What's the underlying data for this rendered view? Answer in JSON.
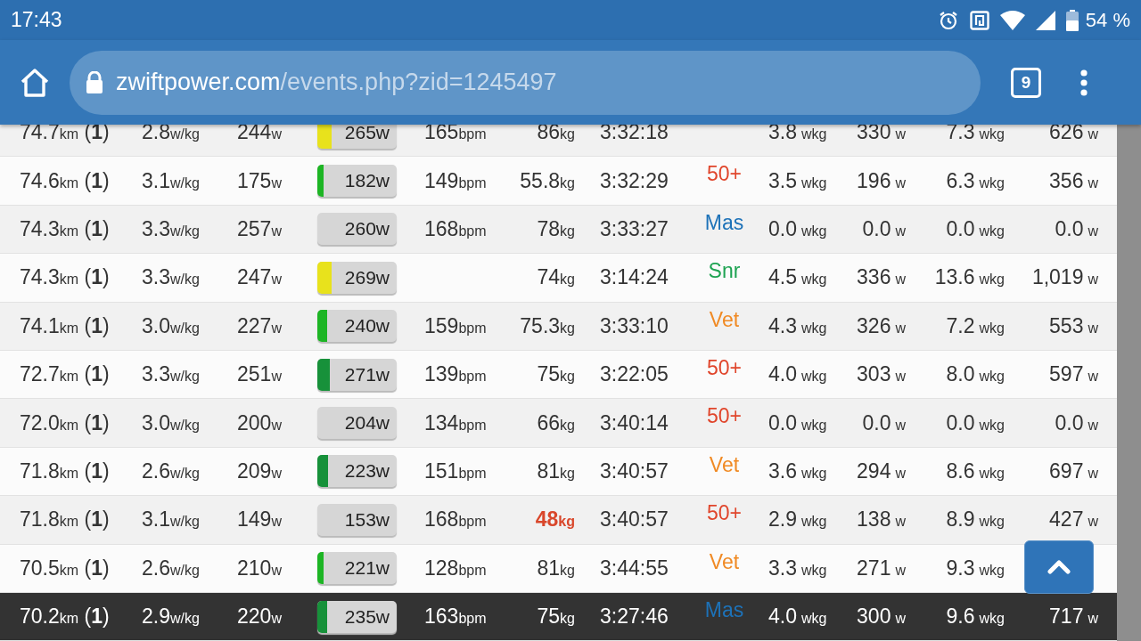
{
  "status_bar": {
    "time": "17:43",
    "battery": "54 %"
  },
  "address_bar": {
    "host": "zwiftpower.com",
    "path": "/events.php?zid=1245497",
    "tab_count": "9"
  },
  "rows": [
    {
      "distance": {
        "v": "74.7",
        "u": "km"
      },
      "rank": "(**1**)",
      "wkg": {
        "v": "2.8",
        "u": "w/kg"
      },
      "avg_power": {
        "v": "244",
        "u": "w"
      },
      "power_bar": {
        "v": "265",
        "u": "w",
        "level": 0.18,
        "color": "#e8e21c"
      },
      "heart_rate": {
        "v": "165",
        "u": "bpm"
      },
      "weight": {
        "v": "86",
        "u": "kg"
      },
      "weight_flagged": false,
      "time": "3:32:18",
      "wkg_1": {
        "v": "3.8",
        "u": "wkg"
      },
      "power_1": {
        "v": "330",
        "u": "w"
      },
      "wkg_2": {
        "v": "7.3",
        "u": "wkg"
      },
      "power_2": {
        "v": "626",
        "u": "w"
      },
      "highlighted": false
    },
    {
      "distance": {
        "v": "74.6",
        "u": "km"
      },
      "rank": "(**1**)",
      "wkg": {
        "v": "3.1",
        "u": "w/kg"
      },
      "avg_power": {
        "v": "175",
        "u": "w"
      },
      "power_bar": {
        "v": "182",
        "u": "w",
        "level": 0.08,
        "color": "#1db524"
      },
      "heart_rate": {
        "v": "149",
        "u": "bpm"
      },
      "weight": {
        "v": "55.8",
        "u": "kg"
      },
      "weight_flagged": false,
      "time": "3:32:29",
      "category": {
        "label": "50+",
        "color": "#e0452b"
      },
      "wkg_1": {
        "v": "3.5",
        "u": "wkg"
      },
      "power_1": {
        "v": "196",
        "u": "w"
      },
      "wkg_2": {
        "v": "6.3",
        "u": "wkg"
      },
      "power_2": {
        "v": "356",
        "u": "w"
      },
      "highlighted": false
    },
    {
      "distance": {
        "v": "74.3",
        "u": "km"
      },
      "rank": "(**1**)",
      "wkg": {
        "v": "3.3",
        "u": "w/kg"
      },
      "avg_power": {
        "v": "257",
        "u": "w"
      },
      "power_bar": {
        "v": "260",
        "u": "w"
      },
      "heart_rate": {
        "v": "168",
        "u": "bpm"
      },
      "weight": {
        "v": "78",
        "u": "kg"
      },
      "weight_flagged": false,
      "time": "3:33:27",
      "category": {
        "label": "Mas",
        "color": "#1d72b8"
      },
      "wkg_1": {
        "v": "0.0",
        "u": "wkg"
      },
      "power_1": {
        "v": "0.0",
        "u": "w"
      },
      "wkg_2": {
        "v": "0.0",
        "u": "wkg"
      },
      "power_2": {
        "v": "0.0",
        "u": "w"
      },
      "highlighted": false
    },
    {
      "distance": {
        "v": "74.3",
        "u": "km"
      },
      "rank": "(**1**)",
      "wkg": {
        "v": "3.3",
        "u": "w/kg"
      },
      "avg_power": {
        "v": "247",
        "u": "w"
      },
      "power_bar": {
        "v": "269",
        "u": "w",
        "level": 0.18,
        "color": "#e8e21c"
      },
      "weight": {
        "v": "74",
        "u": "kg"
      },
      "weight_flagged": false,
      "time": "3:14:24",
      "category": {
        "label": "Snr",
        "color": "#1ea352"
      },
      "wkg_1": {
        "v": "4.5",
        "u": "wkg"
      },
      "power_1": {
        "v": "336",
        "u": "w"
      },
      "wkg_2": {
        "v": "13.6",
        "u": "wkg"
      },
      "power_2": {
        "v": "1,019",
        "u": "w"
      },
      "highlighted": false
    },
    {
      "distance": {
        "v": "74.1",
        "u": "km"
      },
      "rank": "(**1**)",
      "wkg": {
        "v": "3.0",
        "u": "w/kg"
      },
      "avg_power": {
        "v": "227",
        "u": "w"
      },
      "power_bar": {
        "v": "240",
        "u": "w",
        "level": 0.12,
        "color": "#1db524"
      },
      "heart_rate": {
        "v": "159",
        "u": "bpm"
      },
      "weight": {
        "v": "75.3",
        "u": "kg"
      },
      "weight_flagged": false,
      "time": "3:33:10",
      "category": {
        "label": "Vet",
        "color": "#f08a24"
      },
      "wkg_1": {
        "v": "4.3",
        "u": "wkg"
      },
      "power_1": {
        "v": "326",
        "u": "w"
      },
      "wkg_2": {
        "v": "7.2",
        "u": "wkg"
      },
      "power_2": {
        "v": "553",
        "u": "w"
      },
      "highlighted": false
    },
    {
      "distance": {
        "v": "72.7",
        "u": "km"
      },
      "rank": "(**1**)",
      "wkg": {
        "v": "3.3",
        "u": "w/kg"
      },
      "avg_power": {
        "v": "251",
        "u": "w"
      },
      "power_bar": {
        "v": "271",
        "u": "w",
        "level": 0.16,
        "color": "#17913a"
      },
      "heart_rate": {
        "v": "139",
        "u": "bpm"
      },
      "weight": {
        "v": "75",
        "u": "kg"
      },
      "weight_flagged": false,
      "time": "3:22:05",
      "category": {
        "label": "50+",
        "color": "#e0452b"
      },
      "wkg_1": {
        "v": "4.0",
        "u": "wkg"
      },
      "power_1": {
        "v": "303",
        "u": "w"
      },
      "wkg_2": {
        "v": "8.0",
        "u": "wkg"
      },
      "power_2": {
        "v": "597",
        "u": "w"
      },
      "highlighted": false
    },
    {
      "distance": {
        "v": "72.0",
        "u": "km"
      },
      "rank": "(**1**)",
      "wkg": {
        "v": "3.0",
        "u": "w/kg"
      },
      "avg_power": {
        "v": "200",
        "u": "w"
      },
      "power_bar": {
        "v": "204",
        "u": "w"
      },
      "heart_rate": {
        "v": "134",
        "u": "bpm"
      },
      "weight": {
        "v": "66",
        "u": "kg"
      },
      "weight_flagged": false,
      "time": "3:40:14",
      "category": {
        "label": "50+",
        "color": "#e0452b"
      },
      "wkg_1": {
        "v": "0.0",
        "u": "wkg"
      },
      "power_1": {
        "v": "0.0",
        "u": "w"
      },
      "wkg_2": {
        "v": "0.0",
        "u": "wkg"
      },
      "power_2": {
        "v": "0.0",
        "u": "w"
      },
      "highlighted": false
    },
    {
      "distance": {
        "v": "71.8",
        "u": "km"
      },
      "rank": "(**1**)",
      "wkg": {
        "v": "2.6",
        "u": "w/kg"
      },
      "avg_power": {
        "v": "209",
        "u": "w"
      },
      "power_bar": {
        "v": "223",
        "u": "w",
        "level": 0.14,
        "color": "#17913a"
      },
      "heart_rate": {
        "v": "151",
        "u": "bpm"
      },
      "weight": {
        "v": "81",
        "u": "kg"
      },
      "weight_flagged": false,
      "time": "3:40:57",
      "category": {
        "label": "Vet",
        "color": "#f08a24"
      },
      "wkg_1": {
        "v": "3.6",
        "u": "wkg"
      },
      "power_1": {
        "v": "294",
        "u": "w"
      },
      "wkg_2": {
        "v": "8.6",
        "u": "wkg"
      },
      "power_2": {
        "v": "697",
        "u": "w"
      },
      "highlighted": false
    },
    {
      "distance": {
        "v": "71.8",
        "u": "km"
      },
      "rank": "(**1**)",
      "wkg": {
        "v": "3.1",
        "u": "w/kg"
      },
      "avg_power": {
        "v": "149",
        "u": "w"
      },
      "power_bar": {
        "v": "153",
        "u": "w"
      },
      "heart_rate": {
        "v": "168",
        "u": "bpm"
      },
      "weight": {
        "v": "48",
        "u": "kg"
      },
      "weight_flagged": true,
      "time": "3:40:57",
      "category": {
        "label": "50+",
        "color": "#e0452b"
      },
      "wkg_1": {
        "v": "2.9",
        "u": "wkg"
      },
      "power_1": {
        "v": "138",
        "u": "w"
      },
      "wkg_2": {
        "v": "8.9",
        "u": "wkg"
      },
      "power_2": {
        "v": "427",
        "u": "w"
      },
      "highlighted": false
    },
    {
      "distance": {
        "v": "70.5",
        "u": "km"
      },
      "rank": "(**1**)",
      "wkg": {
        "v": "2.6",
        "u": "w/kg"
      },
      "avg_power": {
        "v": "210",
        "u": "w"
      },
      "power_bar": {
        "v": "221",
        "u": "w",
        "level": 0.08,
        "color": "#1db524"
      },
      "heart_rate": {
        "v": "128",
        "u": "bpm"
      },
      "weight": {
        "v": "81",
        "u": "kg"
      },
      "weight_flagged": false,
      "time": "3:44:55",
      "category": {
        "label": "Vet",
        "color": "#f08a24"
      },
      "wkg_1": {
        "v": "3.3",
        "u": "wkg"
      },
      "power_1": {
        "v": "271",
        "u": "w"
      },
      "wkg_2": {
        "v": "9.3",
        "u": "wkg"
      },
      "highlighted": false
    },
    {
      "distance": {
        "v": "70.2",
        "u": "km"
      },
      "rank": "(**1**)",
      "wkg": {
        "v": "2.9",
        "u": "w/kg"
      },
      "avg_power": {
        "v": "220",
        "u": "w"
      },
      "power_bar": {
        "v": "235",
        "u": "w",
        "level": 0.12,
        "color": "#17913a"
      },
      "heart_rate": {
        "v": "163",
        "u": "bpm"
      },
      "weight": {
        "v": "75",
        "u": "kg"
      },
      "weight_flagged": false,
      "time": "3:27:46",
      "category": {
        "label": "Mas",
        "color": "#1d72b8"
      },
      "wkg_1": {
        "v": "4.0",
        "u": "wkg"
      },
      "power_1": {
        "v": "300",
        "u": "w"
      },
      "wkg_2": {
        "v": "9.6",
        "u": "wkg"
      },
      "power_2": {
        "v": "717",
        "u": "w"
      },
      "highlighted": true
    }
  ]
}
